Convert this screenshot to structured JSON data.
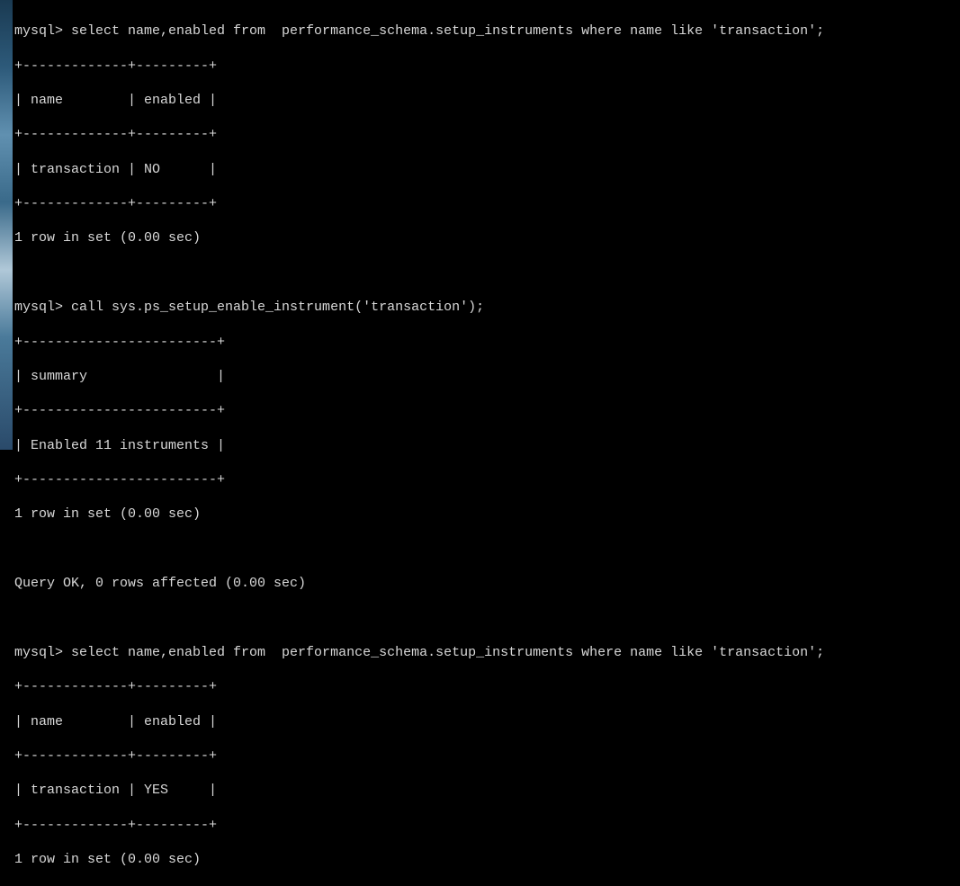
{
  "terminal": {
    "prompt": "mysql> ",
    "block1": {
      "query": "select name,enabled from  performance_schema.setup_instruments where name like 'transaction';",
      "sep_top": "+-------------+---------+",
      "header_row": "| name        | enabled |",
      "sep_mid": "+-------------+---------+",
      "data_row": "| transaction | NO      |",
      "sep_bot": "+-------------+---------+",
      "result": "1 row in set (0.00 sec)"
    },
    "block2": {
      "query": "call sys.ps_setup_enable_instrument('transaction');",
      "sep_top": "+------------------------+",
      "header_row": "| summary                |",
      "sep_mid": "+------------------------+",
      "data_row": "| Enabled 11 instruments |",
      "sep_bot": "+------------------------+",
      "result": "1 row in set (0.00 sec)",
      "status": "Query OK, 0 rows affected (0.00 sec)"
    },
    "block3": {
      "query": "select name,enabled from  performance_schema.setup_instruments where name like 'transaction';",
      "sep_top": "+-------------+---------+",
      "header_row": "| name        | enabled |",
      "sep_mid": "+-------------+---------+",
      "data_row": "| transaction | YES     |",
      "sep_bot": "+-------------+---------+",
      "result": "1 row in set (0.00 sec)"
    }
  }
}
